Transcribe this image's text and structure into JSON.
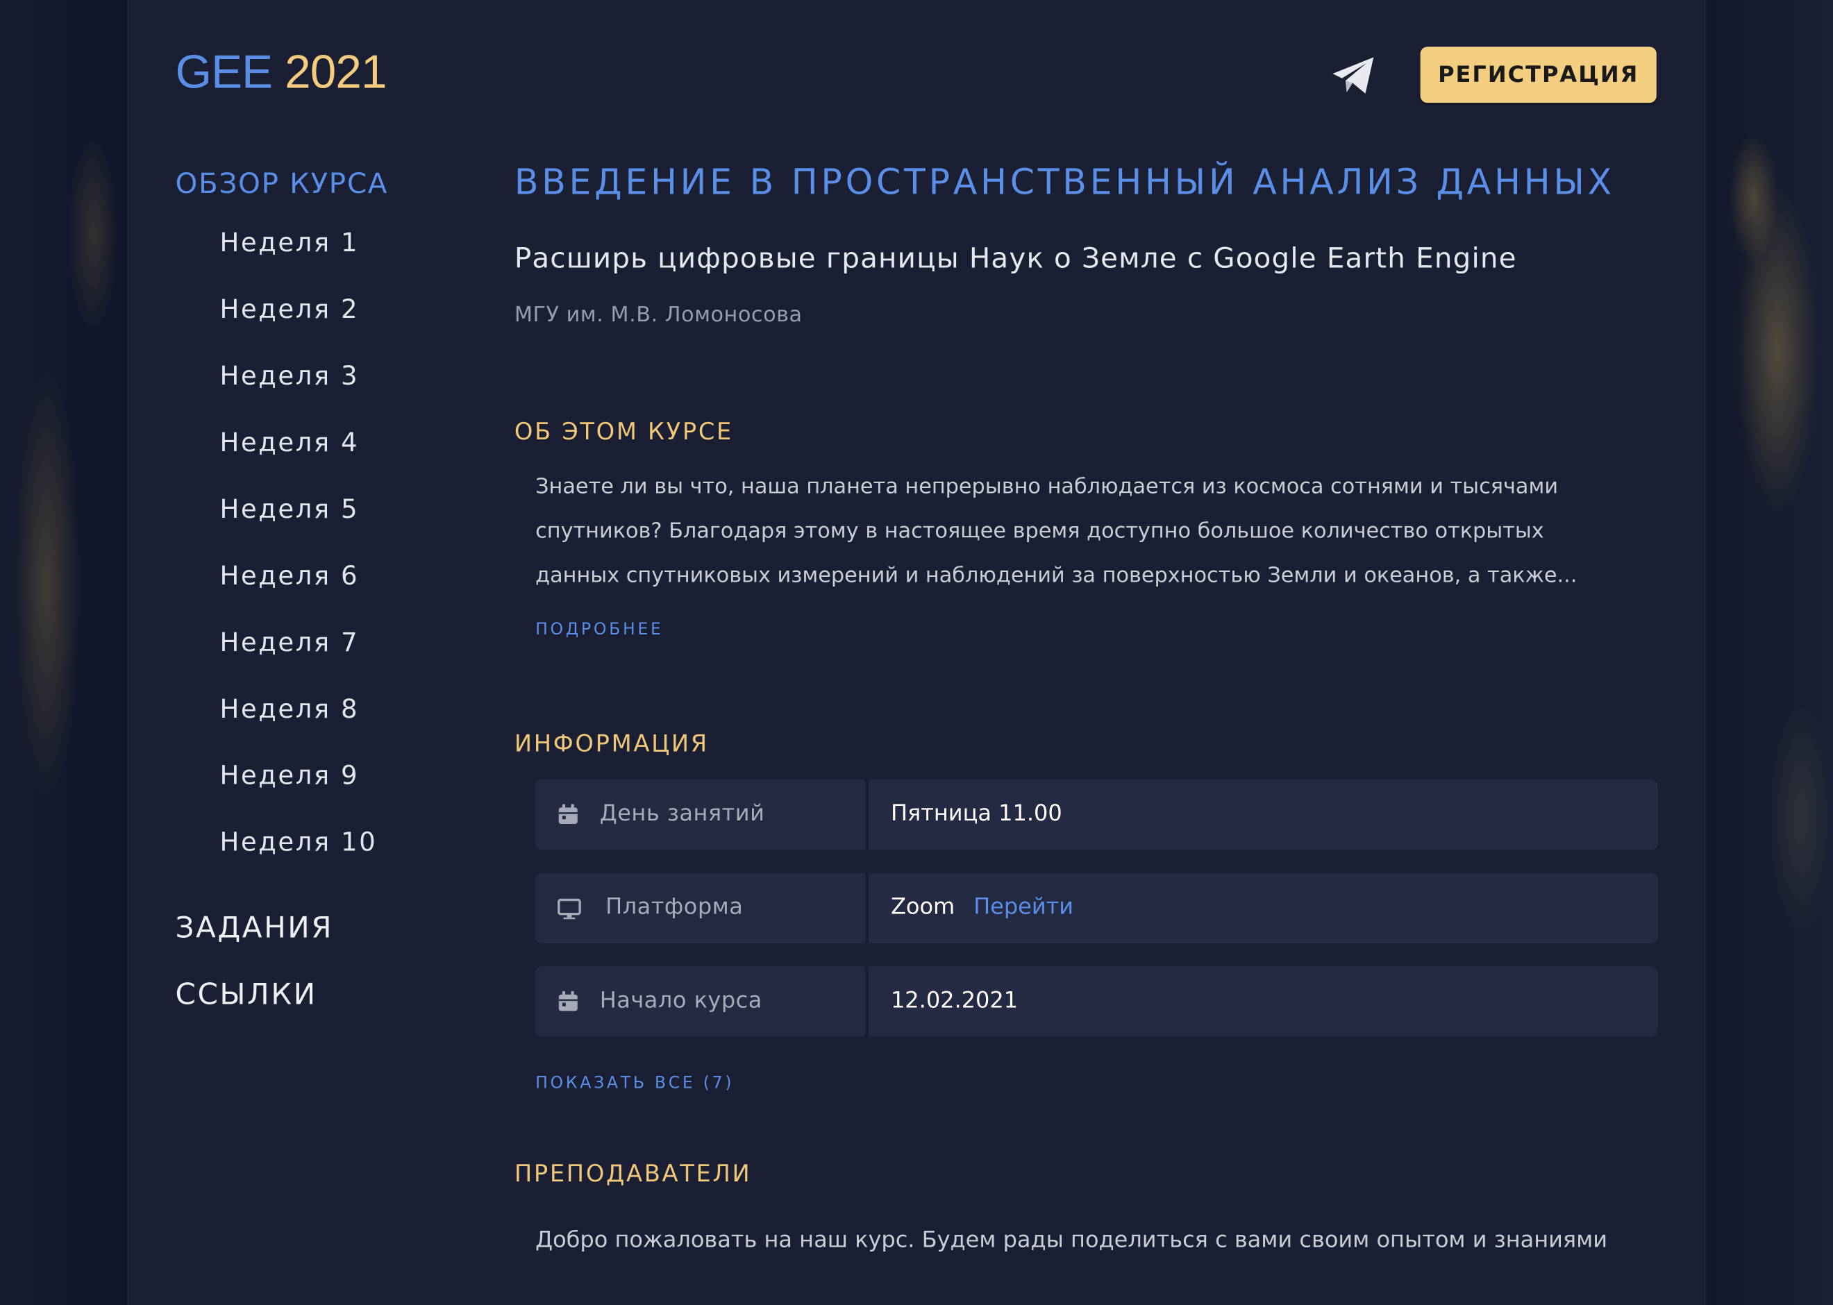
{
  "header": {
    "logo_part1": "GEE",
    "logo_part2": "2021",
    "register_label": "РЕГИСТРАЦИЯ",
    "telegram_icon": "telegram-icon"
  },
  "sidebar": {
    "overview": "ОБЗОР КУРСА",
    "weeks": [
      "Неделя 1",
      "Неделя 2",
      "Неделя 3",
      "Неделя 4",
      "Неделя 5",
      "Неделя 6",
      "Неделя 7",
      "Неделя 8",
      "Неделя 9",
      "Неделя 10"
    ],
    "tasks": "ЗАДАНИЯ",
    "links": "ССЫЛКИ"
  },
  "course": {
    "title": "ВВЕДЕНИЕ В ПРОСТРАНСТВЕННЫЙ АНАЛИЗ ДАННЫХ",
    "subtitle": "Расширь цифровые границы Наук о Земле с Google Earth Engine",
    "organization": "МГУ им. М.В. Ломоносова"
  },
  "about": {
    "heading": "ОБ ЭТОМ КУРСЕ",
    "lines": [
      "Знаете ли вы что, наша планета непрерывно наблюдается из космоса сотнями и тысячами",
      "спутников? Благодаря этому в настоящее время доступно большое количество открытых",
      "данных спутниковых измерений и наблюдений за поверхностью Земли и океанов, а также..."
    ],
    "more_label": "ПОДРОБНЕЕ"
  },
  "info": {
    "heading": "ИНФОРМАЦИЯ",
    "rows": [
      {
        "icon": "calendar-icon",
        "label": "День занятий",
        "value": "Пятница 11.00",
        "link": ""
      },
      {
        "icon": "monitor-icon",
        "label": "Платформа",
        "value": "Zoom",
        "link": "Перейти"
      },
      {
        "icon": "calendar-icon",
        "label": "Начало курса",
        "value": "12.02.2021",
        "link": ""
      }
    ],
    "show_all_label": "ПОКАЗАТЬ ВСЕ (7)"
  },
  "teachers": {
    "heading": "ПРЕПОДАВАТЕЛИ",
    "text": "Добро пожаловать на наш курс. Будем рады поделиться с вами своим опытом и знаниями"
  },
  "colors": {
    "accent_blue": "#5b8ee6",
    "accent_gold": "#f3cd80",
    "panel_bg": "#1a1f33"
  }
}
